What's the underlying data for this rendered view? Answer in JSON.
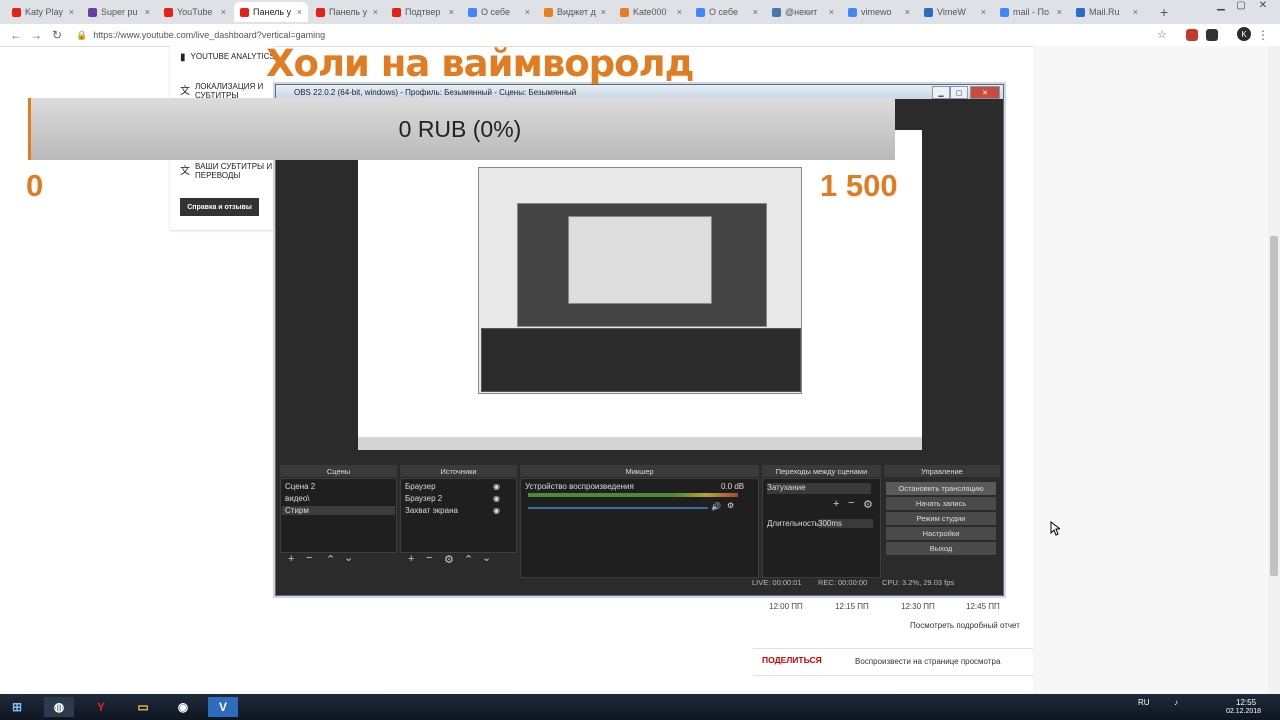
{
  "browser": {
    "tabs": [
      {
        "label": "Katy Play",
        "color": "#e62117"
      },
      {
        "label": "Super pu",
        "color": "#6a3ea1"
      },
      {
        "label": "YouTube",
        "color": "#e62117"
      },
      {
        "label": "Панель у",
        "color": "#e62117",
        "active": true
      },
      {
        "label": "Панель у",
        "color": "#e62117"
      },
      {
        "label": "Подтвер",
        "color": "#e62117"
      },
      {
        "label": "О себе",
        "color": "#4285f4"
      },
      {
        "label": "Виджет д",
        "color": "#e67e22"
      },
      {
        "label": "Kate000",
        "color": "#e67e22"
      },
      {
        "label": "О себе",
        "color": "#4285f4"
      },
      {
        "label": "@некит",
        "color": "#4a76a8"
      },
      {
        "label": "vimewo",
        "color": "#4285f4"
      },
      {
        "label": "VimeW",
        "color": "#2f6bbd"
      },
      {
        "label": "mail - По",
        "color": "#4285f4"
      },
      {
        "label": "Mail.Ru",
        "color": "#2a6dc8"
      }
    ],
    "new_tab": "+",
    "url": "https://www.youtube.com/live_dashboard?vertical=gaming"
  },
  "youtube": {
    "sidebar": [
      {
        "icon": "bar-chart-icon",
        "label": "YOUTUBE ANALYTICS"
      },
      {
        "icon": "translate-icon",
        "label": "ЛОКАЛИЗАЦИЯ И СУБТИТРЫ"
      },
      {
        "icon": "translate-icon",
        "label": "ВАШИ СУБТИТРЫ И ПЕРЕВОДЫ"
      }
    ],
    "help_button": "Справка и отзывы",
    "report_link": "Посмотреть подробный отчет",
    "chart_ticks": [
      "12:00 ПП",
      "12:15 ПП",
      "12:30 ПП",
      "12:45 ПП"
    ],
    "share_tab": "ПОДЕЛИТЬСЯ",
    "share_desc": "Воспроизвести на странице просмотра"
  },
  "overlay": {
    "title": "Холи на ваймворолд",
    "goal_text": "0 RUB (0%)",
    "goal_min": "0",
    "goal_max": "1 500",
    "goal_fraction": 0
  },
  "obs": {
    "title": "OBS 22.0.2 (64-bit, windows) - Профиль: Безымянный - Сцены: Безымянный",
    "panels": {
      "scenes": "Сцены",
      "sources": "Источники",
      "mixer": "Микшер",
      "transitions": "Переходы между сценами",
      "controls": "Управление"
    },
    "scenes": [
      "Сцена 2",
      "видео\\",
      "Стирм"
    ],
    "sources": [
      "Браузер",
      "Браузер 2",
      "Захват экрана"
    ],
    "mixer": {
      "device": "Устройство воспроизведения",
      "level": "0.0 dB"
    },
    "transition": {
      "type": "Затухание",
      "duration_label": "Длительность",
      "duration": "300ms"
    },
    "controls": [
      "Остановить трансляцию",
      "Начать запись",
      "Режим студии",
      "Настройки",
      "Выход"
    ],
    "status": {
      "live": "LIVE: 00:00:01",
      "rec": "REC: 00:00:00",
      "cpu": "CPU: 3.2%, 29.03 fps"
    }
  },
  "taskbar": {
    "lang": "RU",
    "time": "12:55",
    "date": "02.12.2018"
  }
}
